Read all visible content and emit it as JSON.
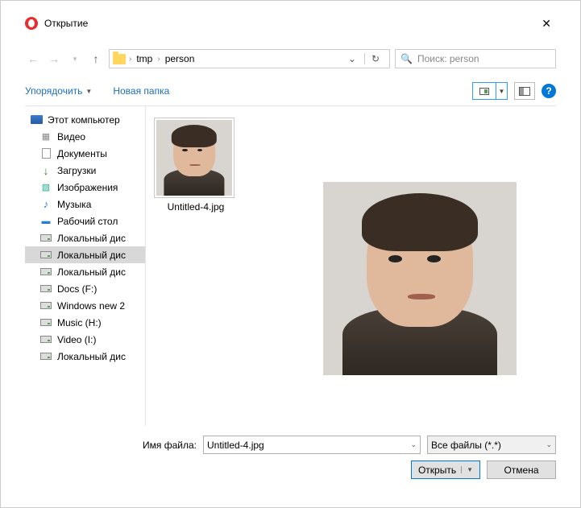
{
  "title": "Открытие",
  "nav": {
    "crumbs": [
      "tmp",
      "person"
    ],
    "search_placeholder": "Поиск: person"
  },
  "toolbar": {
    "organize": "Упорядочить",
    "new_folder": "Новая папка"
  },
  "tree": {
    "root": "Этот компьютер",
    "items": [
      {
        "icon": "video",
        "label": "Видео"
      },
      {
        "icon": "doc",
        "label": "Документы"
      },
      {
        "icon": "download",
        "label": "Загрузки"
      },
      {
        "icon": "image",
        "label": "Изображения"
      },
      {
        "icon": "music",
        "label": "Музыка"
      },
      {
        "icon": "desktop",
        "label": "Рабочий стол"
      },
      {
        "icon": "drive",
        "label": "Локальный дис"
      },
      {
        "icon": "drive",
        "label": "Локальный дис",
        "selected": true
      },
      {
        "icon": "drive",
        "label": "Локальный дис"
      },
      {
        "icon": "drive",
        "label": "Docs (F:)"
      },
      {
        "icon": "drive",
        "label": "Windows new 2"
      },
      {
        "icon": "drive",
        "label": "Music (H:)"
      },
      {
        "icon": "drive",
        "label": "Video (I:)"
      },
      {
        "icon": "drive",
        "label": "Локальный дис"
      }
    ]
  },
  "files": [
    {
      "name": "Untitled-4.jpg"
    }
  ],
  "footer": {
    "filename_label": "Имя файла:",
    "filename_value": "Untitled-4.jpg",
    "filter": "Все файлы (*.*)",
    "open": "Открыть",
    "cancel": "Отмена"
  }
}
